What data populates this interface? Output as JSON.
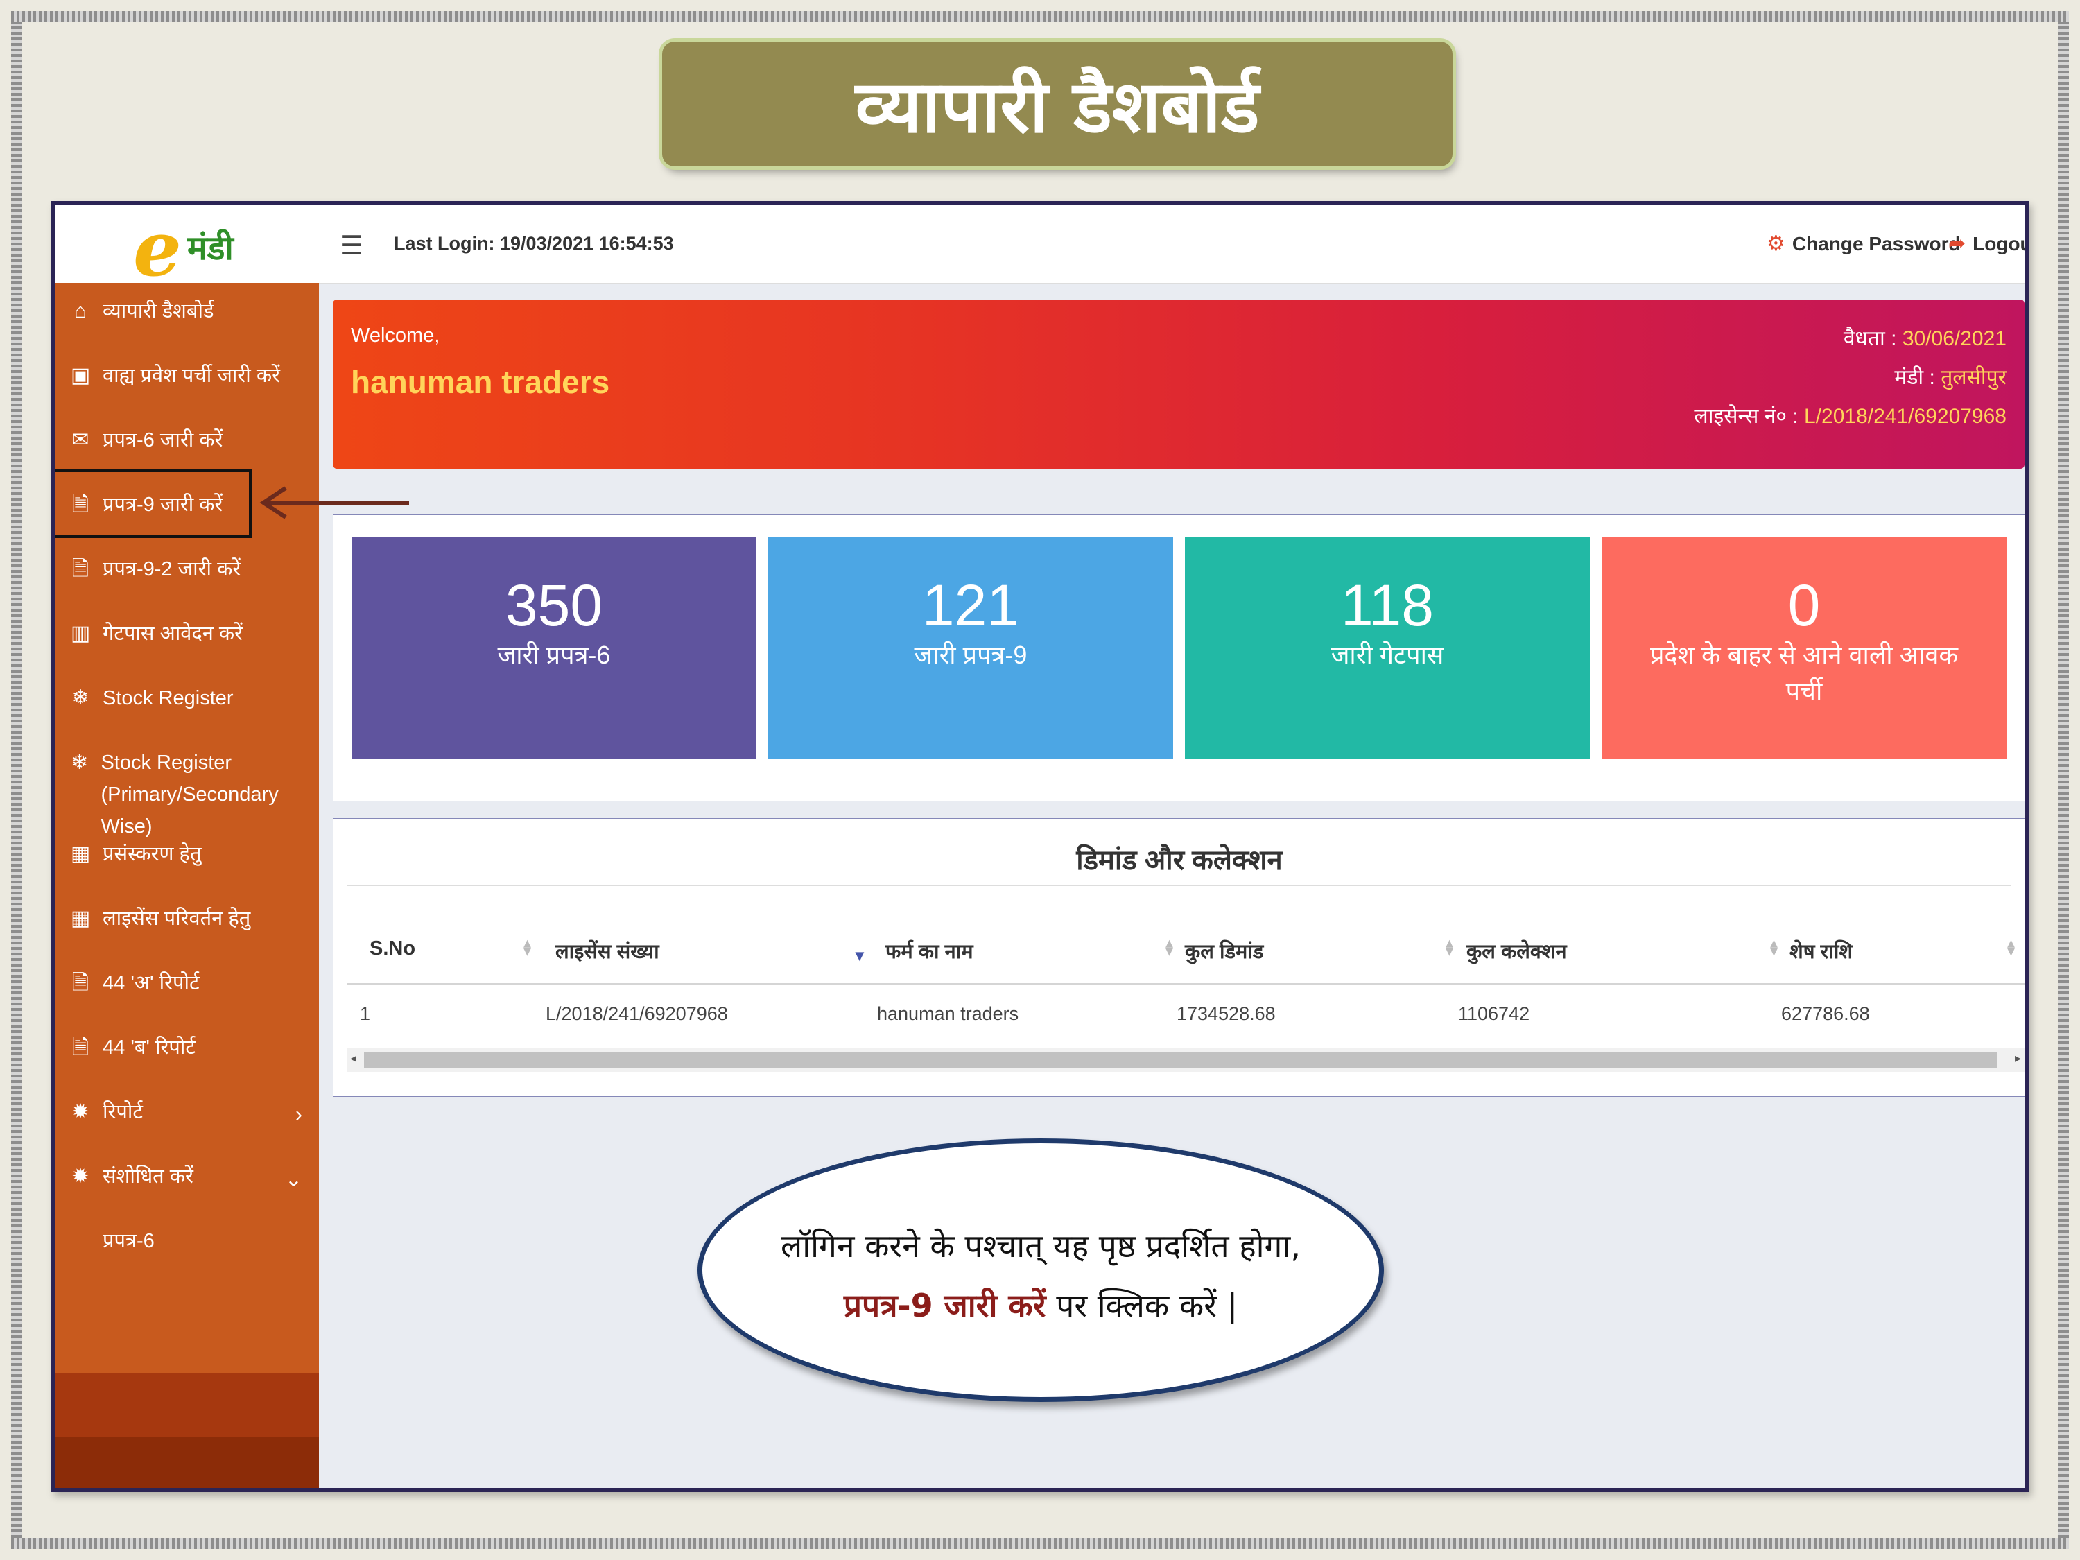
{
  "slide": {
    "title": "व्यापारी डैशबोर्ड"
  },
  "app": {
    "logo": {
      "e": "e",
      "text": "मंडी"
    },
    "header": {
      "menu_icon": "☰",
      "last_login": "Last Login: 19/03/2021 16:54:53",
      "change_password": "Change Password",
      "logout": "Logout"
    },
    "sidebar": {
      "items": [
        {
          "icon": "home-icon",
          "label": "व्यापारी डैशबोर्ड"
        },
        {
          "icon": "entry-pass-icon",
          "label": "वाह्य प्रवेश पर्ची जारी करें"
        },
        {
          "icon": "envelope-check-icon",
          "label": "प्रपत्र-6 जारी करें"
        },
        {
          "icon": "document-icon",
          "label": "प्रपत्र-9 जारी करें"
        },
        {
          "icon": "document-icon",
          "label": "प्रपत्र-9-2 जारी करें"
        },
        {
          "icon": "bar-chart-icon",
          "label": "गेटपास आवेदन करें"
        },
        {
          "icon": "snowflake-icon",
          "label": "Stock Register"
        },
        {
          "icon": "snowflake-icon",
          "label": "Stock Register",
          "label2": "(Primary/Secondary Wise)"
        },
        {
          "icon": "grid-icon",
          "label": "प्रसंस्करण हेतु"
        },
        {
          "icon": "grid-icon",
          "label": "लाइसेंस परिवर्तन हेतु"
        },
        {
          "icon": "document-icon",
          "label": "44 'अ' रिपोर्ट"
        },
        {
          "icon": "document-icon",
          "label": "44 'ब' रिपोर्ट"
        },
        {
          "icon": "gear-icon",
          "label": "रिपोर्ट",
          "chevron": "›"
        },
        {
          "icon": "gear-icon",
          "label": "संशोधित करें",
          "chevron": "⌄"
        }
      ],
      "subitem": "प्रपत्र-6"
    },
    "welcome": {
      "greeting": "Welcome,",
      "firm_name": "hanuman traders",
      "validity_label": "वैधता : ",
      "validity_value": "30/06/2021",
      "mandi_label": "मंडी : ",
      "mandi_value": "तुलसीपुर",
      "license_label": "लाइसेन्स नं० : ",
      "license_value": "L/2018/241/69207968"
    },
    "stats": [
      {
        "value": "350",
        "label": "जारी प्रपत्र-6",
        "color": "#5f549e"
      },
      {
        "value": "121",
        "label": "जारी प्रपत्र-9",
        "color": "#4ca6e4"
      },
      {
        "value": "118",
        "label": "जारी गेटपास",
        "color": "#22b9a5"
      },
      {
        "value": "0",
        "label": "प्रदेश के बाहर से आने वाली आवक पर्ची",
        "color": "#fd6b5f"
      }
    ],
    "demand_table": {
      "title": "डिमांड और कलेक्शन",
      "columns": [
        "S.No",
        "लाइसेंस संख्या",
        "फर्म का नाम",
        "कुल डिमांड",
        "कुल कलेक्शन",
        "शेष राशि"
      ],
      "rows": [
        [
          "1",
          "L/2018/241/69207968",
          "hanuman traders",
          "1734528.68",
          "1106742",
          "627786.68"
        ]
      ]
    }
  },
  "callout": {
    "line1": "लॉगिन करने के पश्चात् यह पृष्ठ प्रदर्शित होगा,",
    "line2_em": "प्रपत्र-9 जारी करें",
    "line2_rest": " पर क्लिक करें |"
  },
  "colors": {
    "sidebar": "#c85a1e",
    "title_box": "#938a50",
    "accent_yellow": "#ffd55a"
  }
}
